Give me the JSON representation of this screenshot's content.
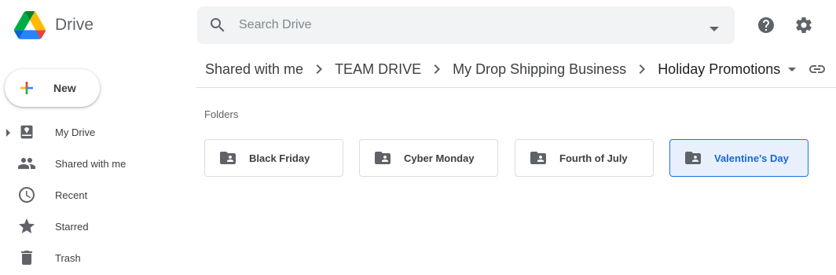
{
  "app": {
    "name": "Drive"
  },
  "search": {
    "placeholder": "Search Drive"
  },
  "new_button": {
    "label": "New"
  },
  "sidebar": {
    "items": [
      {
        "label": "My Drive",
        "icon": "my-drive-icon"
      },
      {
        "label": "Shared with me",
        "icon": "people-icon"
      },
      {
        "label": "Recent",
        "icon": "clock-icon"
      },
      {
        "label": "Starred",
        "icon": "star-icon"
      },
      {
        "label": "Trash",
        "icon": "trash-icon"
      }
    ]
  },
  "breadcrumb": [
    {
      "label": "Shared with me"
    },
    {
      "label": "TEAM DRIVE"
    },
    {
      "label": "My Drop Shipping Business"
    },
    {
      "label": "Holiday Promotions"
    }
  ],
  "folders_section": {
    "title": "Folders",
    "items": [
      {
        "name": "Black Friday",
        "selected": false
      },
      {
        "name": "Cyber Monday",
        "selected": false
      },
      {
        "name": "Fourth of July",
        "selected": false
      },
      {
        "name": "Valentine's Day",
        "selected": true
      }
    ]
  },
  "colors": {
    "accent": "#1a73e8",
    "selected_bg": "#e8f0fe",
    "icon": "#5f6368"
  }
}
